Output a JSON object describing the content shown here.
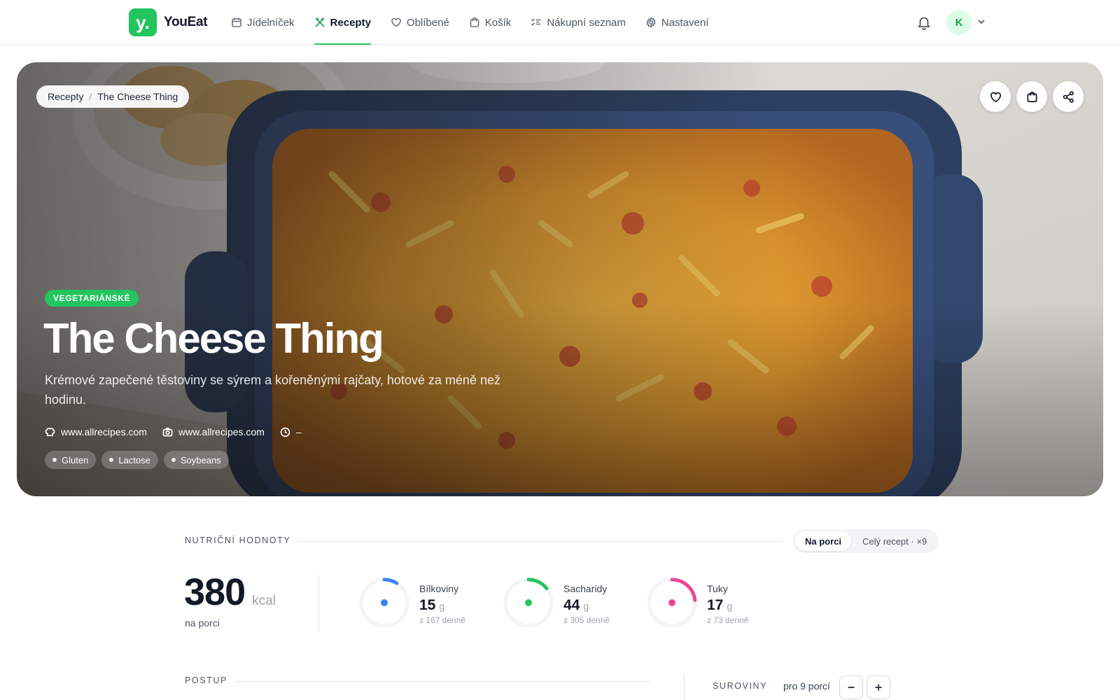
{
  "app": {
    "logo_letter": "y.",
    "name": "YouEat"
  },
  "nav": [
    {
      "label": "Jídelníček",
      "icon": "calendar-icon",
      "active": false
    },
    {
      "label": "Recepty",
      "icon": "utensils-icon",
      "active": true
    },
    {
      "label": "Oblíbené",
      "icon": "heart-icon",
      "active": false
    },
    {
      "label": "Košík",
      "icon": "basket-icon",
      "active": false
    },
    {
      "label": "Nákupní seznam",
      "icon": "checklist-icon",
      "active": false
    },
    {
      "label": "Nastavení",
      "icon": "gear-icon",
      "active": false
    }
  ],
  "user": {
    "initial": "K"
  },
  "breadcrumb": {
    "root": "Recepty",
    "separator": "/",
    "current": "The Cheese Thing"
  },
  "recipe": {
    "diet_badge": "VEGETARIÁNSKÉ",
    "title": "The Cheese Thing",
    "description": "Krémové zapečené těstoviny se sýrem a kořeněnými rajčaty, hotové za méně než hodinu.",
    "source": "www.allrecipes.com",
    "photo_credit": "www.allrecipes.com",
    "time": "–",
    "allergens": [
      "Gluten",
      "Lactose",
      "Soybeans"
    ]
  },
  "nutrition": {
    "section_label": "NUTRIČNÍ HODNOTY",
    "toggle": {
      "per_portion": "Na porci",
      "whole": "Celý recept · ×9"
    },
    "kcal": "380",
    "kcal_unit": "kcal",
    "kcal_sub": "na porci",
    "macros": [
      {
        "name": "Bílkoviny",
        "value": "15",
        "unit": "g",
        "goal": "z 167 denně",
        "fraction": 0.09,
        "color": "#3b82f6"
      },
      {
        "name": "Sacharidy",
        "value": "44",
        "unit": "g",
        "goal": "z 305 denně",
        "fraction": 0.144,
        "color": "#22c55e"
      },
      {
        "name": "Tuky",
        "value": "17",
        "unit": "g",
        "goal": "z 73 denně",
        "fraction": 0.233,
        "color": "#ec4899"
      }
    ]
  },
  "steps": {
    "section_label": "POSTUP"
  },
  "ingredients": {
    "section_label": "SUROVINY",
    "dot": "·",
    "portions": "pro 9 porcí"
  },
  "colors": {
    "accent": "#22c55e",
    "accent_dark": "#16a34a"
  }
}
